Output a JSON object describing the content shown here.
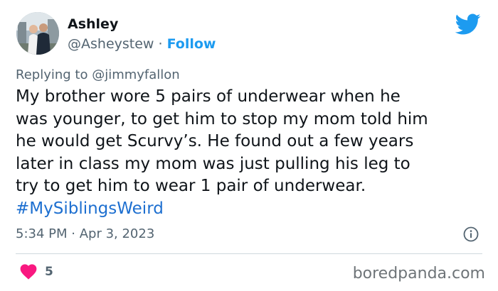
{
  "author": {
    "display_name": "Ashley",
    "handle": "@Asheystew",
    "separator": " · ",
    "follow_label": "Follow"
  },
  "reply": {
    "prefix": "Replying to ",
    "target": "@jimmyfallon"
  },
  "tweet": {
    "lines": [
      "My brother wore 5 pairs of underwear when he",
      "was younger,  to get him to stop my mom told him",
      "he would get Scurvy’s. He found out a few years",
      "later in class my mom was just pulling his leg to",
      "try to get him to wear 1 pair of underwear."
    ],
    "hashtag": "#MySiblingsWeird"
  },
  "meta": {
    "time": "5:34 PM",
    "separator": " · ",
    "date": "Apr 3, 2023"
  },
  "engagement": {
    "likes": "5"
  },
  "watermark": "boredpanda.com",
  "colors": {
    "accent": "#1d9bf0",
    "hashtag": "#1d6fd0",
    "heart": "#f91880",
    "muted": "#536471"
  },
  "icons": {
    "brand": "twitter-bird-icon",
    "info": "info-icon",
    "like": "heart-icon"
  }
}
